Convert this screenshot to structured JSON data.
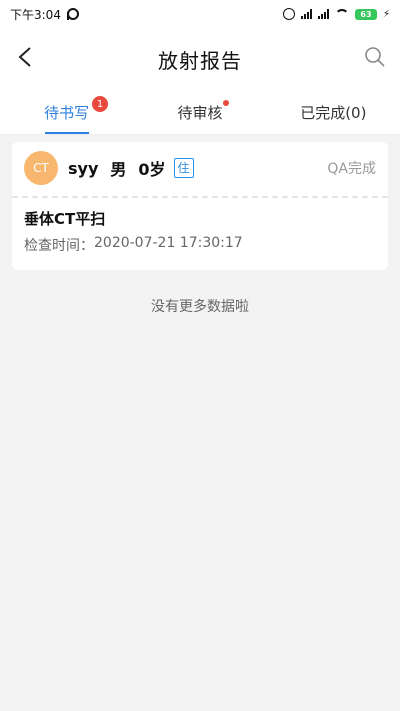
{
  "status_bar": {
    "time": "下午3:04",
    "battery": "63"
  },
  "header": {
    "title": "放射报告"
  },
  "tabs": [
    {
      "label": "待书写",
      "badge": "1"
    },
    {
      "label": "待审核"
    },
    {
      "label": "已完成(0)"
    }
  ],
  "card": {
    "avatar_text": "CT",
    "patient_name": "syy",
    "sex": "男",
    "age": "0岁",
    "tag": "住",
    "qa_status": "QA完成",
    "exam_name": "垂体CT平扫",
    "exam_time_label": "检查时间：",
    "exam_time_value": "2020-07-21 17:30:17"
  },
  "footer_text": "没有更多数据啦",
  "colors": {
    "accent": "#2f7fe0",
    "badge": "#e84a3d",
    "avatar_bg": "#f7b76e"
  }
}
